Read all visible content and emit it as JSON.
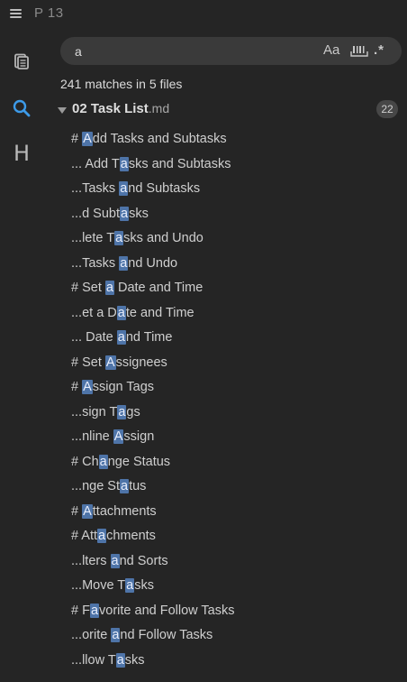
{
  "topbar": {
    "title": "P 13",
    "menu_icon": "hamburger-menu-icon"
  },
  "rail": {
    "items": [
      {
        "name": "files",
        "icon": "copy-pages-icon",
        "active": false
      },
      {
        "name": "search",
        "icon": "search-icon",
        "active": true
      },
      {
        "name": "headings",
        "icon": "heading-icon",
        "glyph": "H",
        "active": false
      }
    ]
  },
  "search": {
    "value": "a",
    "placeholder": "",
    "case_option": "Aa",
    "regex_option": ".*",
    "icons": [
      "match-case-icon",
      "whole-word-icon",
      "regex-icon"
    ]
  },
  "summary": "241 matches in 5 files",
  "file": {
    "name": "02 Task List",
    "ext": ".md",
    "count": "22"
  },
  "matches": [
    {
      "pre": "# ",
      "hit": "A",
      "post": "dd Tasks and Subtasks"
    },
    {
      "pre": "... Add T",
      "hit": "a",
      "post": "sks and Subtasks"
    },
    {
      "pre": "...Tasks ",
      "hit": "a",
      "post": "nd Subtasks"
    },
    {
      "pre": "...d Subt",
      "hit": "a",
      "post": "sks"
    },
    {
      "pre": "...lete T",
      "hit": "a",
      "post": "sks and Undo"
    },
    {
      "pre": "...Tasks ",
      "hit": "a",
      "post": "nd Undo"
    },
    {
      "pre": "# Set ",
      "hit": "a",
      "post": " Date and Time"
    },
    {
      "pre": "...et a D",
      "hit": "a",
      "post": "te and Time"
    },
    {
      "pre": "... Date ",
      "hit": "a",
      "post": "nd Time"
    },
    {
      "pre": "# Set ",
      "hit": "A",
      "post": "ssignees"
    },
    {
      "pre": "# ",
      "hit": "A",
      "post": "ssign Tags"
    },
    {
      "pre": "...sign T",
      "hit": "a",
      "post": "gs"
    },
    {
      "pre": "...nline ",
      "hit": "A",
      "post": "ssign"
    },
    {
      "pre": "# Ch",
      "hit": "a",
      "post": "nge Status"
    },
    {
      "pre": "...nge St",
      "hit": "a",
      "post": "tus"
    },
    {
      "pre": "# ",
      "hit": "A",
      "post": "ttachments"
    },
    {
      "pre": "# Att",
      "hit": "a",
      "post": "chments"
    },
    {
      "pre": "...lters ",
      "hit": "a",
      "post": "nd Sorts"
    },
    {
      "pre": "...Move T",
      "hit": "a",
      "post": "sks"
    },
    {
      "pre": "# F",
      "hit": "a",
      "post": "vorite and Follow Tasks"
    },
    {
      "pre": "...orite ",
      "hit": "a",
      "post": "nd Follow Tasks"
    },
    {
      "pre": "...llow T",
      "hit": "a",
      "post": "sks"
    }
  ],
  "colors": {
    "background": "#252525",
    "accent": "#3d9be9",
    "highlight": "#4e74a8",
    "search_bg": "#3a3a3a"
  }
}
